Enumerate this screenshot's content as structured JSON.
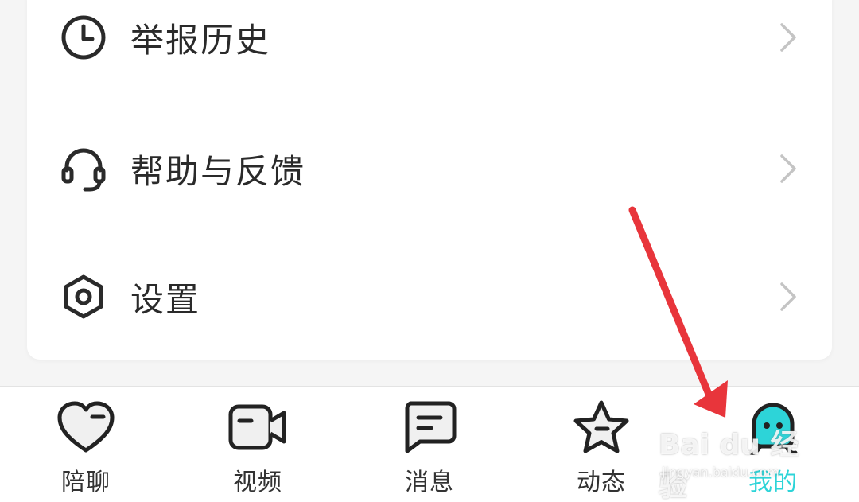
{
  "menu": {
    "items": [
      {
        "label": "举报历史",
        "icon": "clock-icon"
      },
      {
        "label": "帮助与反馈",
        "icon": "headset-icon"
      },
      {
        "label": "设置",
        "icon": "hexagon-settings-icon"
      }
    ]
  },
  "tabbar": {
    "tabs": [
      {
        "label": "陪聊",
        "icon": "heart-icon",
        "active": false
      },
      {
        "label": "视频",
        "icon": "video-camera-icon",
        "active": false
      },
      {
        "label": "消息",
        "icon": "message-bubble-icon",
        "active": false
      },
      {
        "label": "动态",
        "icon": "star-icon",
        "active": false
      },
      {
        "label": "我的",
        "icon": "avatar-icon",
        "active": true
      }
    ]
  },
  "watermark": {
    "main": "Bai du 经验",
    "sub": "jingyan.baidu.com"
  },
  "colors": {
    "accent": "#2dd4d8",
    "arrow": "#e8353b",
    "text": "#2a2a2a"
  }
}
